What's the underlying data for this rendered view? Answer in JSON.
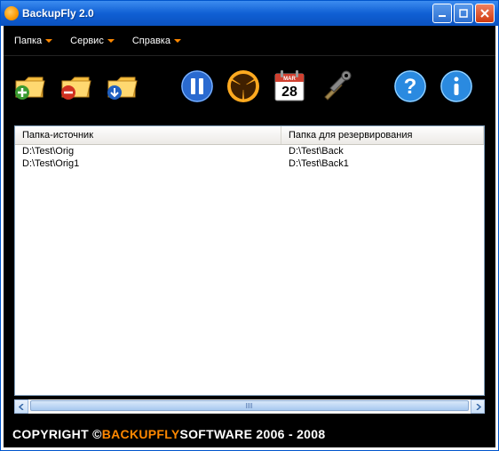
{
  "window": {
    "title": "BackupFly 2.0"
  },
  "menu": {
    "items": [
      "Папка",
      "Сервис",
      "Справка"
    ]
  },
  "table": {
    "headers": [
      "Папка-источник",
      "Папка для резервирования"
    ],
    "rows": [
      {
        "source": "D:\\Test\\Orig",
        "backup": "D:\\Test\\Back"
      },
      {
        "source": "D:\\Test\\Orig1",
        "backup": "D:\\Test\\Back1"
      }
    ]
  },
  "calendar": {
    "month": "MAR",
    "day": "28"
  },
  "footer": {
    "prefix": "COPYRIGHT © ",
    "brand": "BACKUPFLY",
    "suffix": " SOFTWARE 2006 - 2008"
  }
}
